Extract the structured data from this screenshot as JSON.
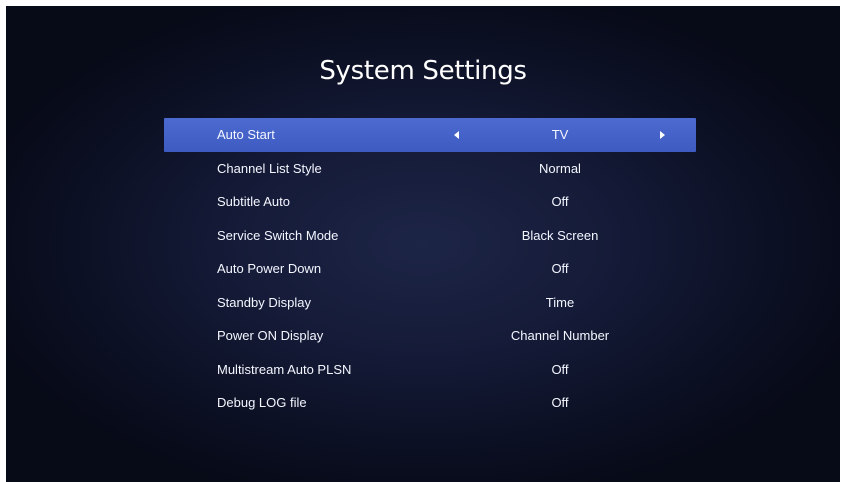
{
  "screen": {
    "title": "System Settings"
  },
  "settings": [
    {
      "label": "Auto Start",
      "value": "TV",
      "selected": true
    },
    {
      "label": "Channel List Style",
      "value": "Normal"
    },
    {
      "label": "Subtitle Auto",
      "value": "Off"
    },
    {
      "label": "Service Switch Mode",
      "value": "Black Screen"
    },
    {
      "label": "Auto Power Down",
      "value": "Off"
    },
    {
      "label": "Standby Display",
      "value": "Time"
    },
    {
      "label": "Power ON Display",
      "value": "Channel Number"
    },
    {
      "label": "Multistream Auto PLSN",
      "value": "Off"
    },
    {
      "label": "Debug LOG file",
      "value": "Off"
    }
  ],
  "icons": {
    "left": "arrow-left-icon",
    "right": "arrow-right-icon"
  },
  "colors": {
    "selection": "#4563c8",
    "background": "#141a36",
    "text": "#ffffff"
  }
}
